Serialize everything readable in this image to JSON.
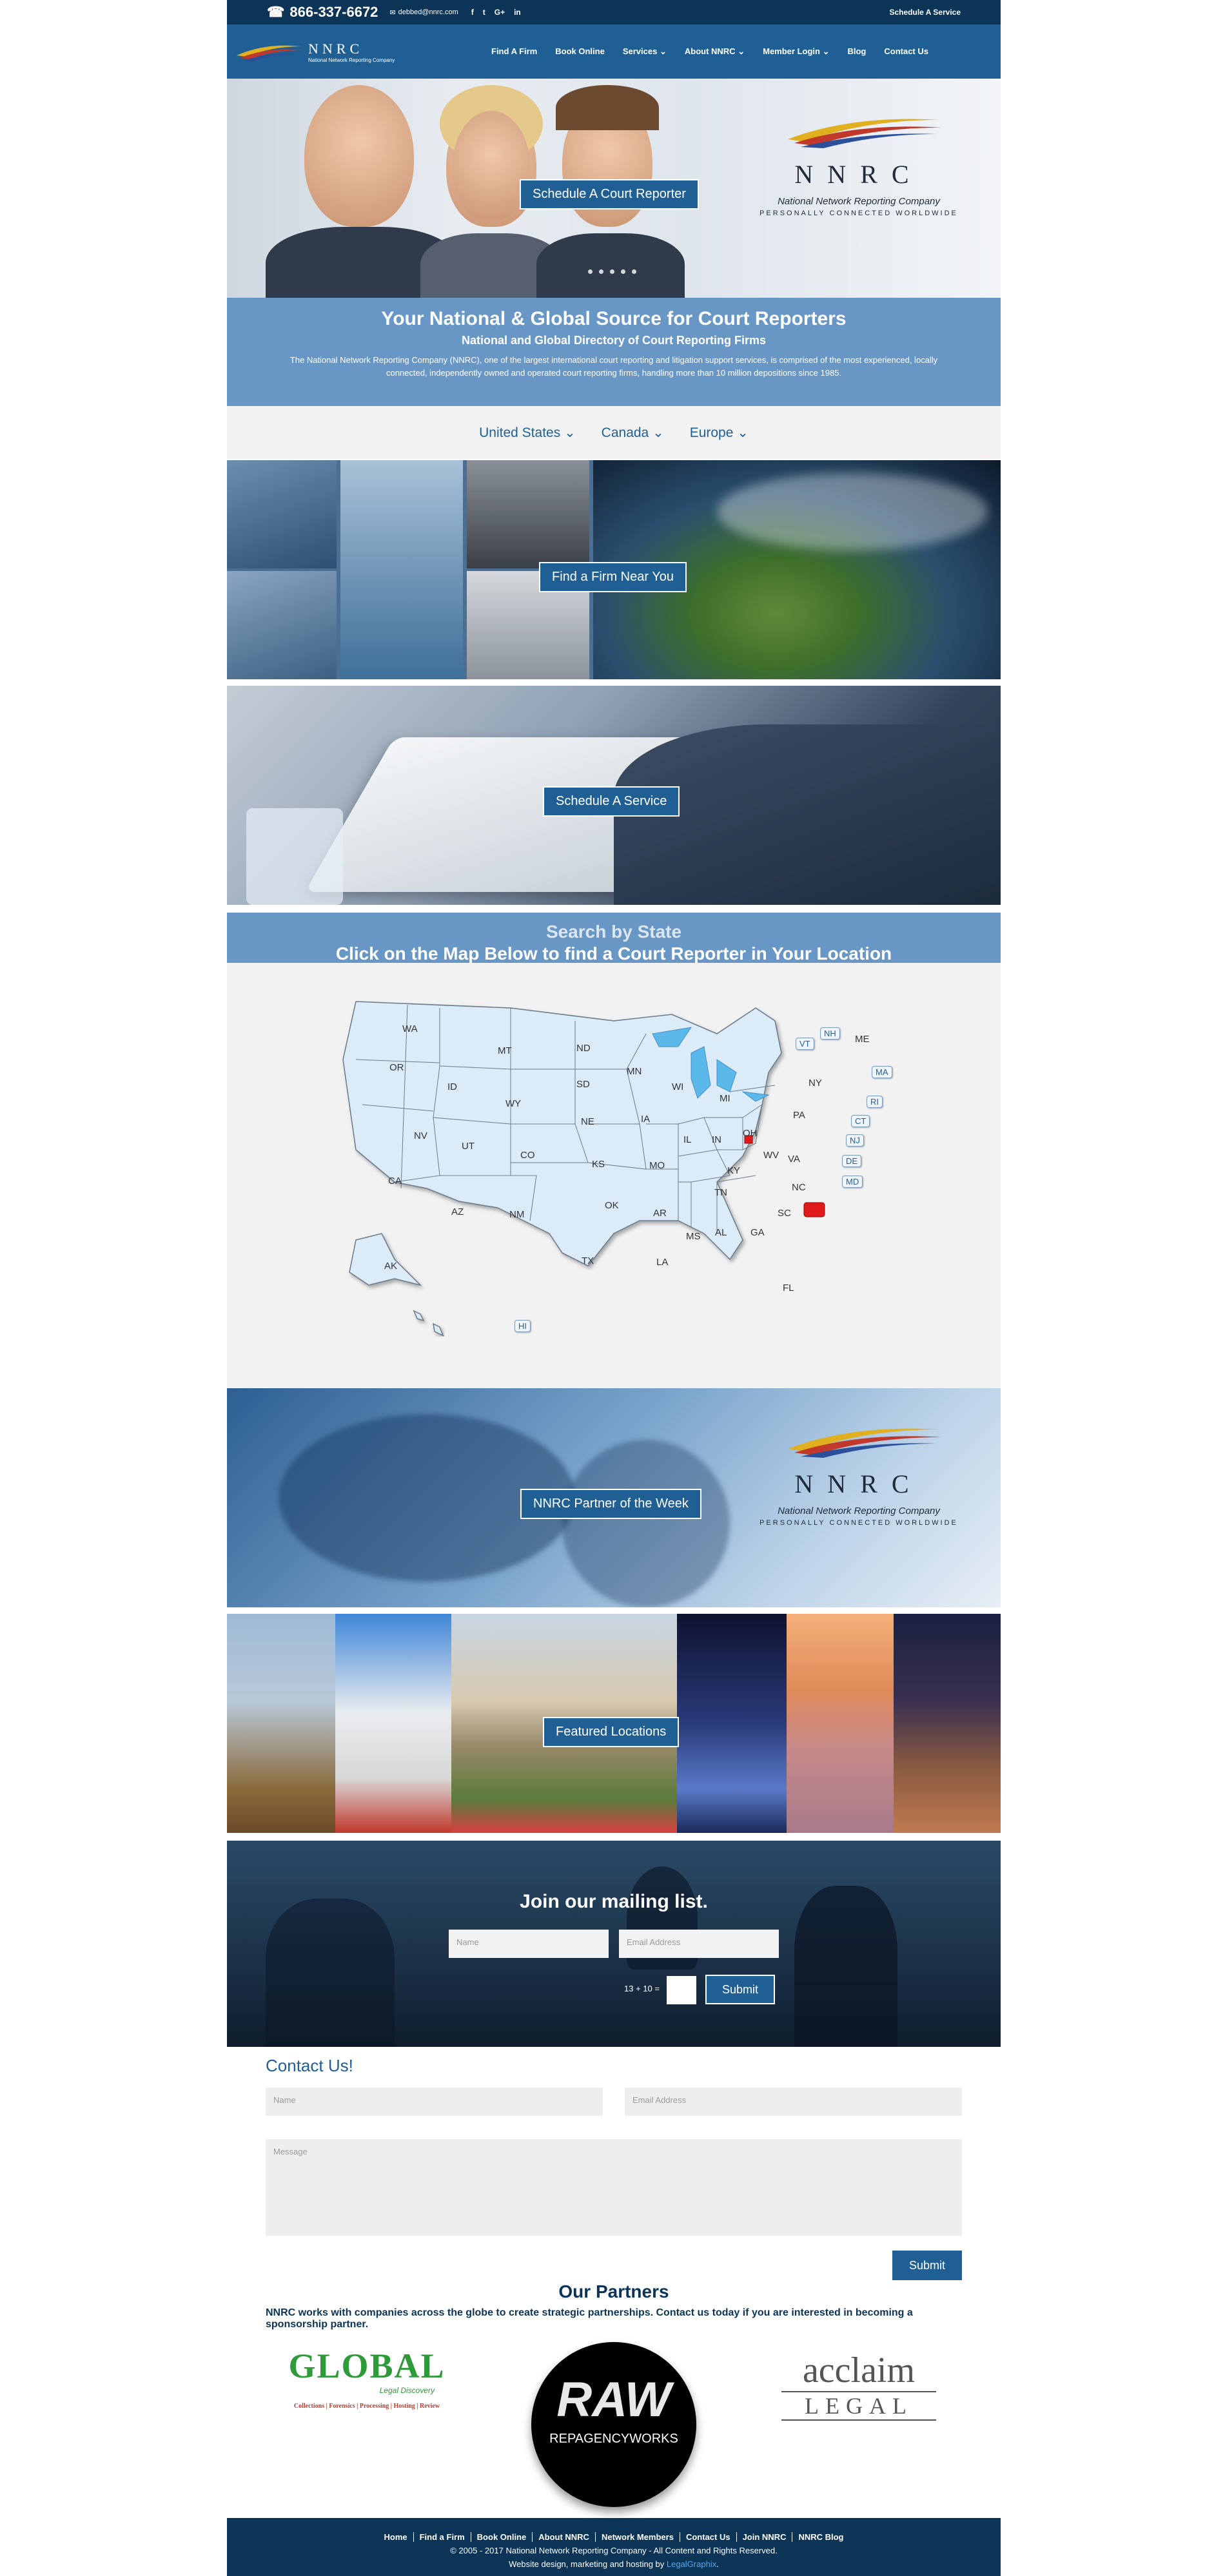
{
  "topbar": {
    "phone": "866-337-6672",
    "email": "debbed@nnrc.com",
    "social": [
      "f",
      "t",
      "G+",
      "in"
    ],
    "schedule": "Schedule A Service"
  },
  "header": {
    "brand": "NNRC",
    "tagline": "National Network Reporting Company",
    "nav": [
      "Find A Firm",
      "Book Online",
      "Services",
      "About NNRC",
      "Member Login",
      "Blog",
      "Contact Us"
    ]
  },
  "hero": {
    "button": "Schedule A Court Reporter",
    "logo_letters": "NNRC",
    "logo_name": "National Network Reporting Company",
    "logo_slogan": "PERSONALLY CONNECTED WORLDWIDE"
  },
  "intro": {
    "title": "Your National & Global Source for Court Reporters",
    "subtitle": "National and Global Directory of Court Reporting Firms",
    "body": "The National Network Reporting Company (NNRC), one of the largest international court reporting and litigation support services, is comprised of the most experienced, locally connected, independently owned and operated court reporting firms, handling more than 10 million depositions since 1985."
  },
  "regions": [
    "United States",
    "Canada",
    "Europe"
  ],
  "banners": {
    "find": "Find a Firm Near You",
    "schedule": "Schedule A Service",
    "partner": "NNRC Partner of the Week",
    "locations": "Featured Locations"
  },
  "state_search": {
    "title": "Search by State",
    "subtitle": "Click on the Map Below to find a Court Reporter in Your Location",
    "states": [
      "WA",
      "OR",
      "ID",
      "MT",
      "ND",
      "SD",
      "WY",
      "NV",
      "UT",
      "CA",
      "CO",
      "NE",
      "KS",
      "AZ",
      "NM",
      "OK",
      "TX",
      "MN",
      "IA",
      "MO",
      "AR",
      "LA",
      "WI",
      "IL",
      "MI",
      "IN",
      "OH",
      "KY",
      "TN",
      "MS",
      "AL",
      "GA",
      "FL",
      "SC",
      "NC",
      "VA",
      "WV",
      "PA",
      "NY",
      "ME",
      "AK"
    ],
    "tags": [
      "VT",
      "NH",
      "MA",
      "RI",
      "CT",
      "NJ",
      "DE",
      "MD",
      "HI"
    ]
  },
  "mailing": {
    "title": "Join our mailing list.",
    "name_placeholder": "Name",
    "email_placeholder": "Email Address",
    "captcha": "13 + 10 =",
    "submit": "Submit"
  },
  "contact": {
    "title": "Contact Us!",
    "name_placeholder": "Name",
    "email_placeholder": "Email Address",
    "message_placeholder": "Message",
    "submit": "Submit"
  },
  "partners": {
    "title": "Our Partners",
    "text": "NNRC works with companies across the globe to create strategic partnerships. Contact us today if you are interested in becoming a sponsorship partner.",
    "global_name": "GLOBAL",
    "global_sub": "Legal Discovery",
    "global_services": "Collections | Forensics | Processing | Hosting | Review",
    "raw_name": "RAW",
    "raw_sub": "REPAGENCYWORKS",
    "acclaim_name": "acclaim",
    "acclaim_sub": "LEGAL"
  },
  "footer": {
    "links": [
      "Home",
      "Find a Firm",
      "Book Online",
      "About NNRC",
      "Network Members",
      "Contact Us",
      "Join NNRC",
      "NNRC Blog"
    ],
    "copyright": "© 2005 - 2017 National Network Reporting Company - All Content and Rights Reserved.",
    "credit_prefix": "Website design, marketing and hosting by",
    "credit_link": "LegalGraphix",
    "credit_suffix": "."
  }
}
